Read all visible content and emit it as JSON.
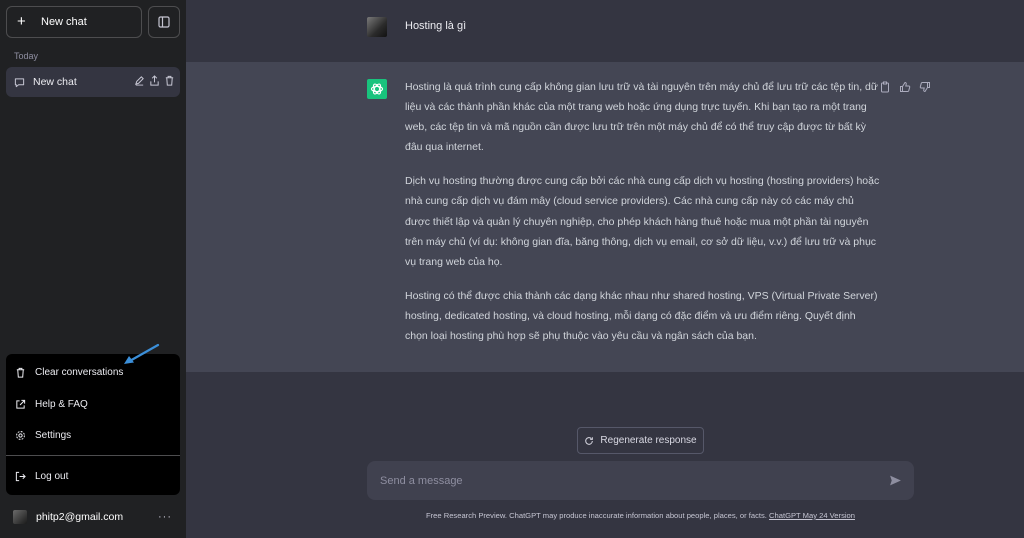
{
  "sidebar": {
    "new_chat_label": "New chat",
    "section_today": "Today",
    "chat_items": [
      {
        "label": "New chat"
      }
    ],
    "menu": {
      "clear": "Clear conversations",
      "help": "Help & FAQ",
      "settings": "Settings",
      "logout": "Log out"
    },
    "user_email": "phitp2@gmail.com",
    "user_more": "···"
  },
  "conversation": {
    "user_message": "Hosting là gì",
    "assistant_paragraphs": [
      "Hosting là quá trình cung cấp không gian lưu trữ và tài nguyên trên máy chủ để lưu trữ các tệp tin, dữ liệu và các thành phần khác của một trang web hoặc ứng dụng trực tuyến. Khi bạn tạo ra một trang web, các tệp tin và mã nguồn cần được lưu trữ trên một máy chủ để có thể truy cập được từ bất kỳ đâu qua internet.",
      "Dịch vụ hosting thường được cung cấp bởi các nhà cung cấp dịch vụ hosting (hosting providers) hoặc nhà cung cấp dịch vụ đám mây (cloud service providers). Các nhà cung cấp này có các máy chủ được thiết lập và quản lý chuyên nghiệp, cho phép khách hàng thuê hoặc mua một phần tài nguyên trên máy chủ (ví dụ: không gian đĩa, băng thông, dịch vụ email, cơ sở dữ liệu, v.v.) để lưu trữ và phục vụ trang web của họ.",
      "Hosting có thể được chia thành các dạng khác nhau như shared hosting, VPS (Virtual Private Server) hosting, dedicated hosting, và cloud hosting, mỗi dạng có đặc điểm và ưu điểm riêng. Quyết định chọn loại hosting phù hợp sẽ phụ thuộc vào yêu cầu và ngân sách của bạn."
    ]
  },
  "composer": {
    "regenerate_label": "Regenerate response",
    "placeholder": "Send a message",
    "footer_text": "Free Research Preview. ChatGPT may produce inaccurate information about people, places, or facts. ",
    "footer_link": "ChatGPT May 24 Version"
  },
  "colors": {
    "sidebar_bg": "#202123",
    "main_bg": "#343541",
    "assistant_bg": "#444654",
    "gpt_green": "#19c37d",
    "annotation_arrow": "#3b8fd9"
  }
}
